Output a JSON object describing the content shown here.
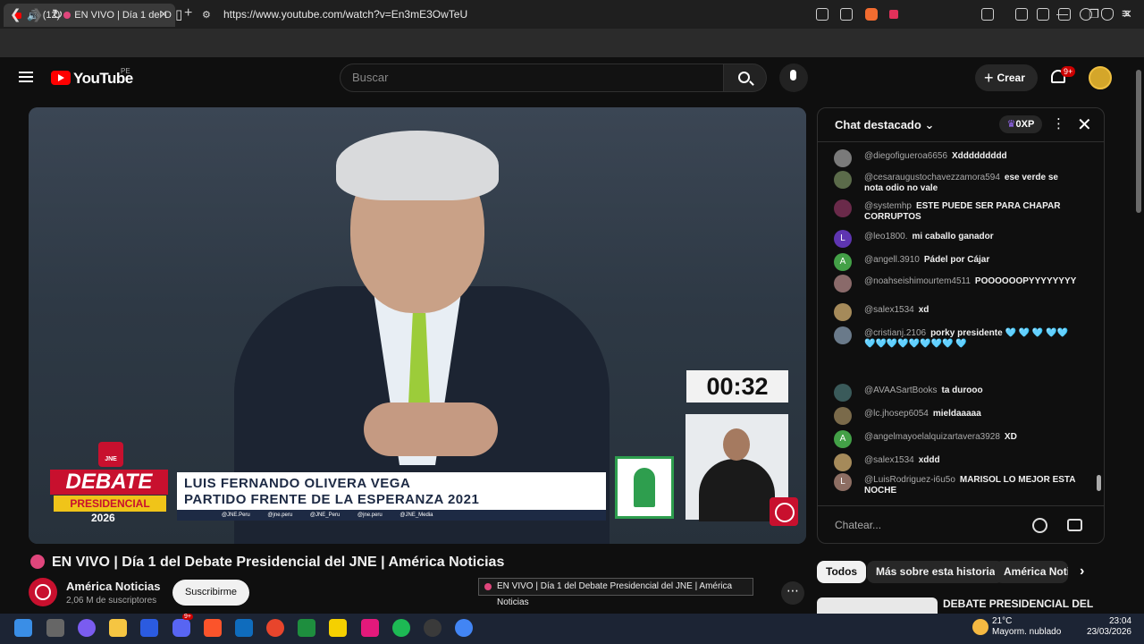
{
  "browser": {
    "tab_count": "(12)",
    "tab_title": "EN VIVO | Día 1 del D",
    "url": "https://www.youtube.com/watch?v=En3mE3OwTeU"
  },
  "youtube": {
    "logo_text": "YouTube",
    "country_code": "PE",
    "search_placeholder": "Buscar",
    "create_label": "Crear",
    "notifications_badge": "9+"
  },
  "video": {
    "timer": "00:32",
    "debate_label": "DEBATE",
    "presidencial_label": "PRESIDENCIAL",
    "year_label": "2026",
    "jne_label": "JNE",
    "candidate_name": "LUIS FERNANDO OLIVERA VEGA",
    "party_name": "PARTIDO FRENTE DE LA ESPERANZA 2021",
    "social_handles": "@JNE.Peru @jne.peru @JNE_Peru @jne.peru @JNE_Media"
  },
  "video_info": {
    "title": "EN VIVO | Día 1 del Debate Presidencial del JNE | América Noticias",
    "channel_name": "América Noticias",
    "subscribers": "2,06 M de suscriptores",
    "subscribe_label": "Suscribirme",
    "tooltip": "EN VIVO | Día 1 del Debate Presidencial del JNE | América Noticias"
  },
  "chat": {
    "title": "Chat destacado",
    "xp_badge": "0XP",
    "input_placeholder": "Chatear...",
    "messages": [
      {
        "user": "@diegofigueroa6656",
        "text": "Xddddddddd",
        "avatar_color": "#7a7a7a",
        "initial": ""
      },
      {
        "user": "@cesaraugustochavezzamora594",
        "text": "ese verde se nota odio no vale",
        "avatar_color": "#5b6b4a",
        "initial": ""
      },
      {
        "user": "@systemhp",
        "text": "ESTE PUEDE SER PARA CHAPAR CORRUPTOS",
        "avatar_color": "#6a2a4a",
        "initial": ""
      },
      {
        "user": "@leo1800.",
        "text": "mi caballo ganador",
        "avatar_color": "#5e35b1",
        "initial": "L"
      },
      {
        "user": "@angell.3910",
        "text": "Pádel por Cájar",
        "avatar_color": "#43a047",
        "initial": "A"
      },
      {
        "user": "@noahseishimourtem4511",
        "text": "POOOOOOPYYYYYYYY",
        "avatar_color": "#8a6a6a",
        "initial": ""
      },
      {
        "user": "@salex1534",
        "text": "xd",
        "avatar_color": "#a58a5a",
        "initial": ""
      },
      {
        "user": "@cristianj.2106",
        "text": "porky presidente 🩵 🩵 🩵 🩵🩵🩵🩵🩵🩵🩵🩵🩵🩵 🩵",
        "avatar_color": "#6a7a8a",
        "initial": ""
      },
      {
        "user": "@AVAASartBooks",
        "text": "ta durooo",
        "avatar_color": "#3a5a5a",
        "initial": ""
      },
      {
        "user": "@lc.jhosep6054",
        "text": "mieldaaaaa",
        "avatar_color": "#7a6a4a",
        "initial": ""
      },
      {
        "user": "@angelmayoelalquizartavera3928",
        "text": "XD",
        "avatar_color": "#43a047",
        "initial": "A"
      },
      {
        "user": "@salex1534",
        "text": "xddd",
        "avatar_color": "#a58a5a",
        "initial": ""
      },
      {
        "user": "@LuisRodriguez-i6u5o",
        "text": "MARISOL LO MEJOR ESTA NOCHE",
        "avatar_color": "#8d6e63",
        "initial": "L"
      }
    ]
  },
  "chips": [
    "Todos",
    "Más sobre esta historia",
    "América Noti"
  ],
  "recommended": {
    "title": "DEBATE PRESIDENCIAL DEL"
  },
  "taskbar": {
    "temperature": "21°C",
    "weather": "Mayorm. nublado",
    "time": "23:04",
    "date": "23/03/2026",
    "discord_badge": "9+"
  }
}
